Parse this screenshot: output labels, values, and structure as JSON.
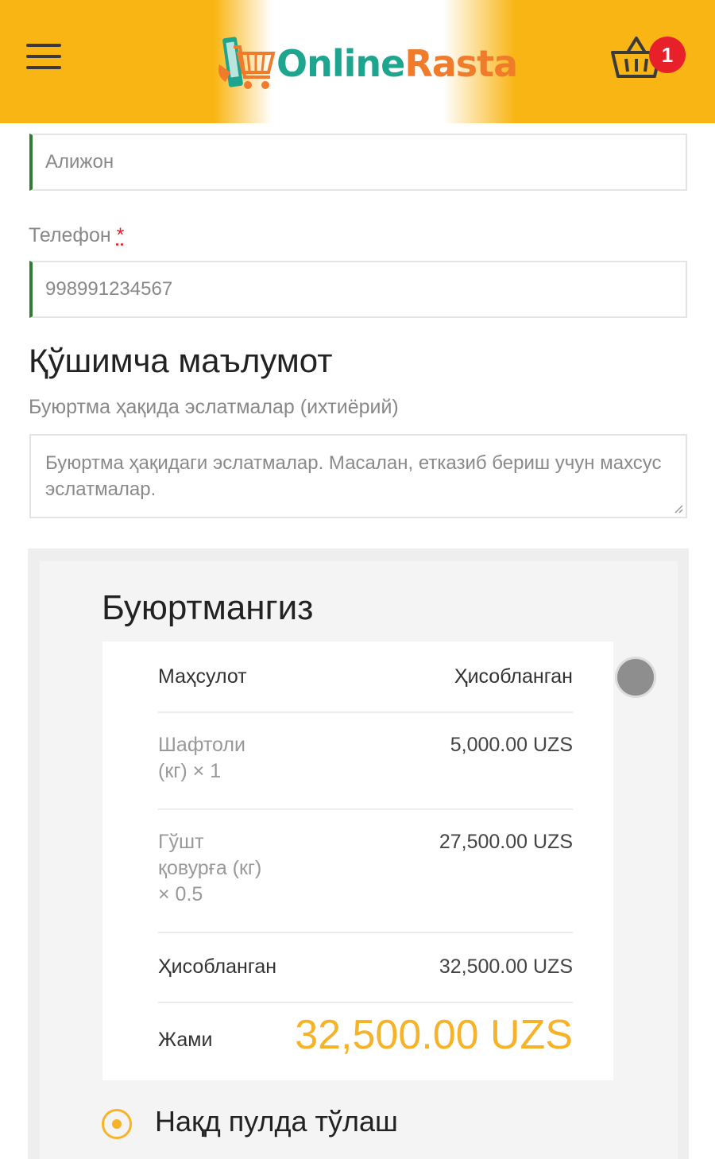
{
  "header": {
    "logo_part1": "Online",
    "logo_part2": "Rasta",
    "cart_count": "1",
    "brand_color": "#f9b514"
  },
  "form": {
    "name_value": "Алижон",
    "phone_label": "Телефон",
    "phone_required": "*",
    "phone_value": "998991234567"
  },
  "additional": {
    "title": "Қўшимча маълумот",
    "notes_label": "Буюртма ҳақида эслатмалар (ихтиёрий)",
    "notes_placeholder": "Буюртма ҳақидаги эслатмалар. Масалан, етказиб бериш учун махсус эслатмалар."
  },
  "order": {
    "title": "Буюртмангиз",
    "col_product": "Маҳсулот",
    "col_subtotal": "Ҳисобланган",
    "items": [
      {
        "name_line1": "Шафтоли",
        "name_line2": "(кг)  × 1",
        "name_line3": "",
        "price": "5,000.00 UZS"
      },
      {
        "name_line1": "Гўшт",
        "name_line2": "қовурға (кг)",
        "name_line3": "× 0.5",
        "price": "27,500.00 UZS"
      }
    ],
    "subtotal_label": "Ҳисобланган",
    "subtotal_value": "32,500.00 UZS",
    "total_label": "Жами",
    "total_value": "32,500.00 UZS",
    "accent_color": "#f6b327"
  },
  "payment": {
    "option_label": "Нақд пулда тўлаш"
  }
}
